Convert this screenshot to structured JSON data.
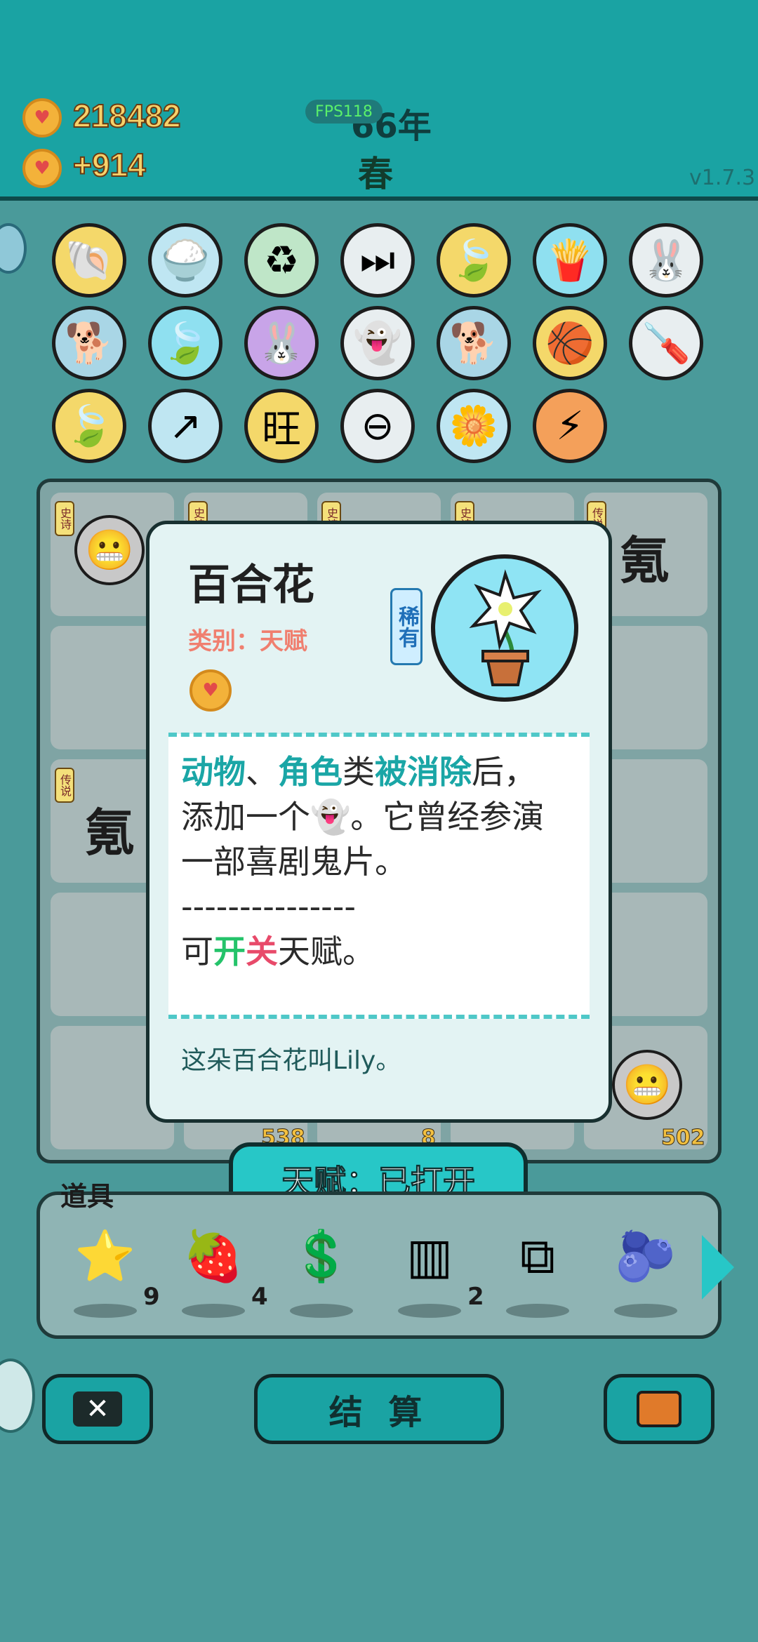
{
  "header": {
    "coins": "218482",
    "income": "+914",
    "fps": "FPS118",
    "year": "66年",
    "season": "春",
    "version": "v1.7.3"
  },
  "symbols": [
    {
      "icon": "shell",
      "glyph": "🐚",
      "bg": "#f4d86a"
    },
    {
      "icon": "rice-bowl",
      "glyph": "🍚",
      "bg": "#bfe6f2"
    },
    {
      "icon": "recycle",
      "glyph": "♻",
      "bg": "#bfe6c8"
    },
    {
      "icon": "skip",
      "glyph": "⏭",
      "bg": "#e8eef0"
    },
    {
      "icon": "leaf",
      "glyph": "🍃",
      "bg": "#f4d86a"
    },
    {
      "icon": "fries",
      "glyph": "🍟",
      "bg": "#8fe0f0"
    },
    {
      "icon": "rabbit",
      "glyph": "🐰",
      "bg": "#e8eef0"
    },
    {
      "icon": "dog",
      "glyph": "🐕",
      "bg": "#a9d6e6"
    },
    {
      "icon": "leaf",
      "glyph": "🍃",
      "bg": "#8fe0f0"
    },
    {
      "icon": "rabbit",
      "glyph": "🐰",
      "bg": "#c8a4e8"
    },
    {
      "icon": "ghost",
      "glyph": "👻",
      "bg": "#e8eef0"
    },
    {
      "icon": "dog",
      "glyph": "🐕",
      "bg": "#a9d6e6"
    },
    {
      "icon": "basketballs",
      "glyph": "🏀",
      "bg": "#f4d86a"
    },
    {
      "icon": "screwdriver",
      "glyph": "🪛",
      "bg": "#e8eef0"
    },
    {
      "icon": "leaf",
      "glyph": "🍃",
      "bg": "#f4d86a"
    },
    {
      "icon": "arrow-box",
      "glyph": "↗",
      "bg": "#bfe6f2"
    },
    {
      "icon": "wang",
      "glyph": "旺",
      "bg": "#f4d86a"
    },
    {
      "icon": "minus-circle",
      "glyph": "⊖",
      "bg": "#e8eef0"
    },
    {
      "icon": "lily",
      "glyph": "🌼",
      "bg": "#bfe6f2"
    },
    {
      "icon": "lightning",
      "glyph": "⚡",
      "bg": "#f4a05a"
    }
  ],
  "board": {
    "tags": [
      "史诗",
      "史诗",
      "史诗",
      "史诗",
      "传说",
      "传说"
    ],
    "big_chars": [
      "氪",
      "氪"
    ],
    "numbers": [
      "538",
      "8",
      "502"
    ]
  },
  "popup": {
    "title": "百合花",
    "category": "类别：天赋",
    "rarity": "稀有",
    "line1_a": "动物",
    "line1_b": "、",
    "line1_c": "角色",
    "line1_d": "类",
    "line1_e": "被消除",
    "line1_f": "后，",
    "line2_a": "添加一个",
    "line2_b": "👻",
    "line2_c": "。它曾经参演",
    "line3": "一部喜剧鬼片。",
    "line4": "---------------",
    "line5_a": "可",
    "line5_b": "开",
    "line5_c": "关",
    "line5_d": "天赋。",
    "flavor": "这朵百合花叫Lily。"
  },
  "banner": "天赋：已打开",
  "items": {
    "label": "道具",
    "list": [
      {
        "icon": "star",
        "glyph": "⭐",
        "count": "9"
      },
      {
        "icon": "bayberry",
        "glyph": "🍓",
        "count": "4"
      },
      {
        "icon": "dollar-coin",
        "glyph": "💲",
        "count": ""
      },
      {
        "icon": "pillars",
        "glyph": "▥",
        "count": "2"
      },
      {
        "icon": "copy-paste",
        "glyph": "⧉",
        "count": ""
      },
      {
        "icon": "blueberry",
        "glyph": "🫐",
        "count": ""
      }
    ],
    "next_icon": "chevron-right-icon"
  },
  "buttons": {
    "skip_icon": "close-icon",
    "settle": "结 算",
    "bag_icon": "briefcase-icon"
  },
  "colors": {
    "header": "#1aa3a3",
    "accent": "#27c7c7",
    "highlight": "#1aa6a6",
    "category": "#f07f6f"
  }
}
